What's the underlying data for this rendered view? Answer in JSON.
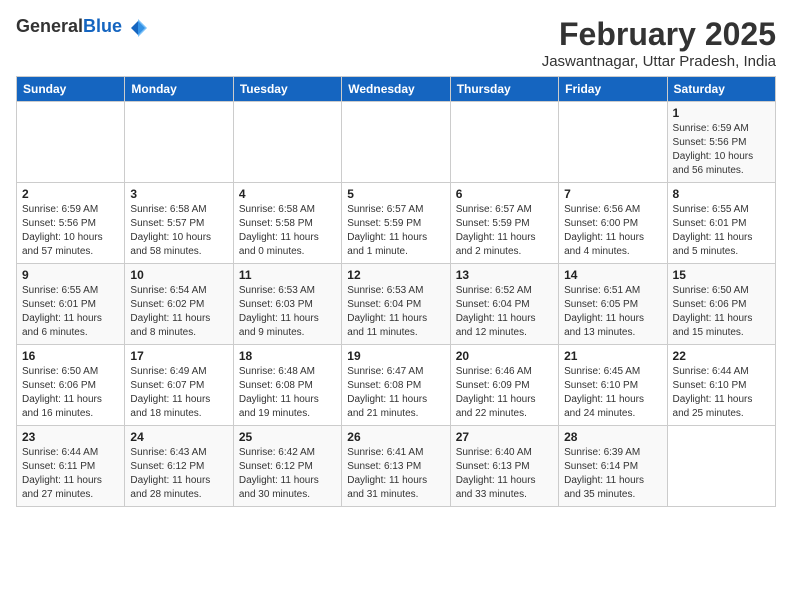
{
  "header": {
    "logo_general": "General",
    "logo_blue": "Blue",
    "title": "February 2025",
    "subtitle": "Jaswantnagar, Uttar Pradesh, India"
  },
  "weekdays": [
    "Sunday",
    "Monday",
    "Tuesday",
    "Wednesday",
    "Thursday",
    "Friday",
    "Saturday"
  ],
  "weeks": [
    [
      {
        "day": "",
        "info": ""
      },
      {
        "day": "",
        "info": ""
      },
      {
        "day": "",
        "info": ""
      },
      {
        "day": "",
        "info": ""
      },
      {
        "day": "",
        "info": ""
      },
      {
        "day": "",
        "info": ""
      },
      {
        "day": "1",
        "info": "Sunrise: 6:59 AM\nSunset: 5:56 PM\nDaylight: 10 hours\nand 56 minutes."
      }
    ],
    [
      {
        "day": "2",
        "info": "Sunrise: 6:59 AM\nSunset: 5:56 PM\nDaylight: 10 hours\nand 57 minutes."
      },
      {
        "day": "3",
        "info": "Sunrise: 6:58 AM\nSunset: 5:57 PM\nDaylight: 10 hours\nand 58 minutes."
      },
      {
        "day": "4",
        "info": "Sunrise: 6:58 AM\nSunset: 5:58 PM\nDaylight: 11 hours\nand 0 minutes."
      },
      {
        "day": "5",
        "info": "Sunrise: 6:57 AM\nSunset: 5:59 PM\nDaylight: 11 hours\nand 1 minute."
      },
      {
        "day": "6",
        "info": "Sunrise: 6:57 AM\nSunset: 5:59 PM\nDaylight: 11 hours\nand 2 minutes."
      },
      {
        "day": "7",
        "info": "Sunrise: 6:56 AM\nSunset: 6:00 PM\nDaylight: 11 hours\nand 4 minutes."
      },
      {
        "day": "8",
        "info": "Sunrise: 6:55 AM\nSunset: 6:01 PM\nDaylight: 11 hours\nand 5 minutes."
      }
    ],
    [
      {
        "day": "9",
        "info": "Sunrise: 6:55 AM\nSunset: 6:01 PM\nDaylight: 11 hours\nand 6 minutes."
      },
      {
        "day": "10",
        "info": "Sunrise: 6:54 AM\nSunset: 6:02 PM\nDaylight: 11 hours\nand 8 minutes."
      },
      {
        "day": "11",
        "info": "Sunrise: 6:53 AM\nSunset: 6:03 PM\nDaylight: 11 hours\nand 9 minutes."
      },
      {
        "day": "12",
        "info": "Sunrise: 6:53 AM\nSunset: 6:04 PM\nDaylight: 11 hours\nand 11 minutes."
      },
      {
        "day": "13",
        "info": "Sunrise: 6:52 AM\nSunset: 6:04 PM\nDaylight: 11 hours\nand 12 minutes."
      },
      {
        "day": "14",
        "info": "Sunrise: 6:51 AM\nSunset: 6:05 PM\nDaylight: 11 hours\nand 13 minutes."
      },
      {
        "day": "15",
        "info": "Sunrise: 6:50 AM\nSunset: 6:06 PM\nDaylight: 11 hours\nand 15 minutes."
      }
    ],
    [
      {
        "day": "16",
        "info": "Sunrise: 6:50 AM\nSunset: 6:06 PM\nDaylight: 11 hours\nand 16 minutes."
      },
      {
        "day": "17",
        "info": "Sunrise: 6:49 AM\nSunset: 6:07 PM\nDaylight: 11 hours\nand 18 minutes."
      },
      {
        "day": "18",
        "info": "Sunrise: 6:48 AM\nSunset: 6:08 PM\nDaylight: 11 hours\nand 19 minutes."
      },
      {
        "day": "19",
        "info": "Sunrise: 6:47 AM\nSunset: 6:08 PM\nDaylight: 11 hours\nand 21 minutes."
      },
      {
        "day": "20",
        "info": "Sunrise: 6:46 AM\nSunset: 6:09 PM\nDaylight: 11 hours\nand 22 minutes."
      },
      {
        "day": "21",
        "info": "Sunrise: 6:45 AM\nSunset: 6:10 PM\nDaylight: 11 hours\nand 24 minutes."
      },
      {
        "day": "22",
        "info": "Sunrise: 6:44 AM\nSunset: 6:10 PM\nDaylight: 11 hours\nand 25 minutes."
      }
    ],
    [
      {
        "day": "23",
        "info": "Sunrise: 6:44 AM\nSunset: 6:11 PM\nDaylight: 11 hours\nand 27 minutes."
      },
      {
        "day": "24",
        "info": "Sunrise: 6:43 AM\nSunset: 6:12 PM\nDaylight: 11 hours\nand 28 minutes."
      },
      {
        "day": "25",
        "info": "Sunrise: 6:42 AM\nSunset: 6:12 PM\nDaylight: 11 hours\nand 30 minutes."
      },
      {
        "day": "26",
        "info": "Sunrise: 6:41 AM\nSunset: 6:13 PM\nDaylight: 11 hours\nand 31 minutes."
      },
      {
        "day": "27",
        "info": "Sunrise: 6:40 AM\nSunset: 6:13 PM\nDaylight: 11 hours\nand 33 minutes."
      },
      {
        "day": "28",
        "info": "Sunrise: 6:39 AM\nSunset: 6:14 PM\nDaylight: 11 hours\nand 35 minutes."
      },
      {
        "day": "",
        "info": ""
      }
    ]
  ]
}
